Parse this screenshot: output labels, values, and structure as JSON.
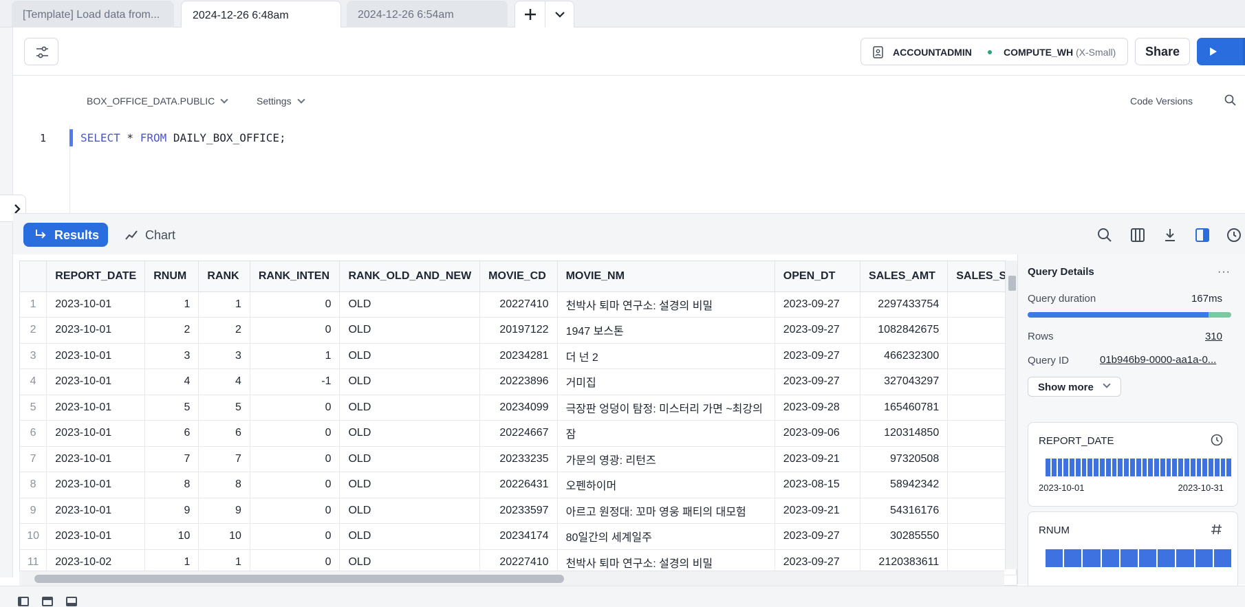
{
  "tabs": [
    {
      "label": "[Template] Load data from..."
    },
    {
      "label": "2024-12-26 6:48am"
    },
    {
      "label": "2024-12-26 6:54am"
    }
  ],
  "toolbar": {
    "role": "ACCOUNTADMIN",
    "warehouse": "COMPUTE_WH",
    "warehouse_size": "(X-Small)",
    "share_label": "Share"
  },
  "editor": {
    "db_context": "BOX_OFFICE_DATA.PUBLIC",
    "settings_label": "Settings",
    "code_versions_label": "Code Versions",
    "line_number": "1",
    "code_kw1": "SELECT",
    "code_mid": " * ",
    "code_kw2": "FROM",
    "code_rest": " DAILY_BOX_OFFICE;"
  },
  "results": {
    "results_label": "Results",
    "chart_label": "Chart"
  },
  "grid": {
    "columns": [
      "REPORT_DATE",
      "RNUM",
      "RANK",
      "RANK_INTEN",
      "RANK_OLD_AND_NEW",
      "MOVIE_CD",
      "MOVIE_NM",
      "OPEN_DT",
      "SALES_AMT",
      "SALES_S"
    ],
    "rows": [
      [
        "1",
        "2023-10-01",
        "1",
        "1",
        "0",
        "OLD",
        "20227410",
        "천박사 퇴마 연구소: 설경의 비밀",
        "2023-09-27",
        "2297433754"
      ],
      [
        "2",
        "2023-10-01",
        "2",
        "2",
        "0",
        "OLD",
        "20197122",
        "1947 보스톤",
        "2023-09-27",
        "1082842675"
      ],
      [
        "3",
        "2023-10-01",
        "3",
        "3",
        "1",
        "OLD",
        "20234281",
        "더 넌 2",
        "2023-09-27",
        "466232300"
      ],
      [
        "4",
        "2023-10-01",
        "4",
        "4",
        "-1",
        "OLD",
        "20223896",
        "거미집",
        "2023-09-27",
        "327043297"
      ],
      [
        "5",
        "2023-10-01",
        "5",
        "5",
        "0",
        "OLD",
        "20234099",
        "극장판 엉덩이 탐정: 미스터리 가면 ~최강의",
        "2023-09-28",
        "165460781"
      ],
      [
        "6",
        "2023-10-01",
        "6",
        "6",
        "0",
        "OLD",
        "20224667",
        "잠",
        "2023-09-06",
        "120314850"
      ],
      [
        "7",
        "2023-10-01",
        "7",
        "7",
        "0",
        "OLD",
        "20233235",
        "가문의 영광: 리턴즈",
        "2023-09-21",
        "97320508"
      ],
      [
        "8",
        "2023-10-01",
        "8",
        "8",
        "0",
        "OLD",
        "20226431",
        "오펜하이머",
        "2023-08-15",
        "58942342"
      ],
      [
        "9",
        "2023-10-01",
        "9",
        "9",
        "0",
        "OLD",
        "20233597",
        "아르고 원정대: 꼬마 영웅 패티의 대모험",
        "2023-09-21",
        "54316176"
      ],
      [
        "10",
        "2023-10-01",
        "10",
        "10",
        "0",
        "OLD",
        "20234174",
        "80일간의 세계일주",
        "2023-09-27",
        "30285550"
      ],
      [
        "11",
        "2023-10-02",
        "1",
        "1",
        "0",
        "OLD",
        "20227410",
        "천박사 퇴마 연구소: 설경의 비밀",
        "2023-09-27",
        "2120383611"
      ]
    ]
  },
  "query_details": {
    "title": "Query Details",
    "more": "···",
    "duration_label": "Query duration",
    "duration_value": "167ms",
    "duration_fill_fraction": 0.89,
    "rows_label": "Rows",
    "rows_value": "310",
    "query_id_label": "Query ID",
    "query_id_value": "01b946b9-0000-aa1a-0...",
    "show_more_label": "Show more"
  },
  "column_cards": [
    {
      "name": "REPORT_DATE",
      "icon": "clock-icon",
      "range_lo": "2023-10-01",
      "range_hi": "2023-10-31"
    },
    {
      "name": "RNUM",
      "icon": "hash-icon"
    }
  ],
  "colors": {
    "accent": "#2a6dde",
    "bar_duration": "#3d78e6",
    "bar_rest": "#7ac9a0",
    "histogram": "#3d72e0"
  }
}
